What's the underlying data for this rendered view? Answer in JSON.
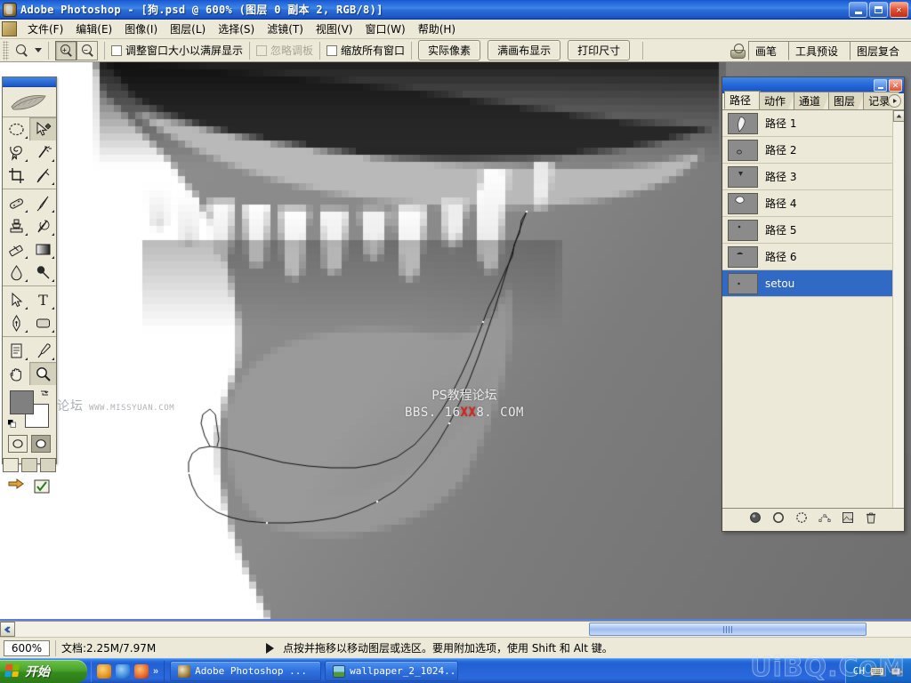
{
  "window": {
    "app_title": "Adobe Photoshop - [狗.psd @ 600% (图层 0 副本 2, RGB/8)]",
    "minimize_label": "最小化",
    "restore_label": "还原",
    "close_label": "关闭"
  },
  "menu": {
    "items": [
      {
        "label": "文件(F)"
      },
      {
        "label": "编辑(E)"
      },
      {
        "label": "图像(I)"
      },
      {
        "label": "图层(L)"
      },
      {
        "label": "选择(S)"
      },
      {
        "label": "滤镜(T)"
      },
      {
        "label": "视图(V)"
      },
      {
        "label": "窗口(W)"
      },
      {
        "label": "帮助(H)"
      }
    ]
  },
  "options_bar": {
    "active_tool": "zoom-tool",
    "checkbox_resize_windows": "调整窗口大小以满屏显示",
    "checkbox_ignore_palettes": "忽略调板",
    "checkbox_zoom_all_windows": "缩放所有窗口",
    "button_actual_pixels": "实际像素",
    "button_fit_on_screen": "满画布显示",
    "button_print_size": "打印尺寸",
    "dock_tabs": [
      "画笔",
      "工具预设",
      "图层复合"
    ]
  },
  "toolbox": {
    "foreground_color": "#808080",
    "background_color": "#ffffff",
    "tools": [
      {
        "name": "marquee-tool",
        "glyph": "ellipse"
      },
      {
        "name": "move-tool",
        "glyph": "move",
        "selected": true
      },
      {
        "name": "lasso-tool",
        "glyph": "lasso"
      },
      {
        "name": "magic-wand-tool",
        "glyph": "wand"
      },
      {
        "name": "crop-tool",
        "glyph": "crop"
      },
      {
        "name": "slice-tool",
        "glyph": "slice"
      },
      {
        "name": "healing-brush-tool",
        "glyph": "heal"
      },
      {
        "name": "brush-tool",
        "glyph": "brush"
      },
      {
        "name": "clone-stamp-tool",
        "glyph": "stamp"
      },
      {
        "name": "history-brush-tool",
        "glyph": "history"
      },
      {
        "name": "eraser-tool",
        "glyph": "eraser"
      },
      {
        "name": "gradient-tool",
        "glyph": "gradient"
      },
      {
        "name": "blur-tool",
        "glyph": "drop"
      },
      {
        "name": "dodge-tool",
        "glyph": "dodge"
      },
      {
        "name": "path-selection-tool",
        "glyph": "arrow"
      },
      {
        "name": "type-tool",
        "glyph": "T"
      },
      {
        "name": "pen-tool",
        "glyph": "pen"
      },
      {
        "name": "shape-tool",
        "glyph": "rect"
      },
      {
        "name": "notes-tool",
        "glyph": "note"
      },
      {
        "name": "eyedropper-tool",
        "glyph": "dropper"
      },
      {
        "name": "hand-tool",
        "glyph": "hand"
      },
      {
        "name": "zoom-tool",
        "glyph": "magnifier"
      }
    ]
  },
  "paths_panel": {
    "tabs": [
      {
        "label": "路径",
        "active": true
      },
      {
        "label": "动作",
        "active": false
      },
      {
        "label": "通道",
        "active": false
      },
      {
        "label": "图层",
        "active": false
      },
      {
        "label": "记录",
        "active": false
      }
    ],
    "rows": [
      {
        "name": "路径 1",
        "selected": false
      },
      {
        "name": "路径 2",
        "selected": false
      },
      {
        "name": "路径 3",
        "selected": false
      },
      {
        "name": "路径 4",
        "selected": false
      },
      {
        "name": "路径 5",
        "selected": false
      },
      {
        "name": "路径 6",
        "selected": false
      },
      {
        "name": "setou",
        "selected": true
      }
    ],
    "selected_color": "#316ac5",
    "footer_buttons": [
      {
        "name": "fill-path-button"
      },
      {
        "name": "stroke-path-button"
      },
      {
        "name": "load-path-as-selection-button"
      },
      {
        "name": "make-work-path-button"
      },
      {
        "name": "create-new-path-button"
      },
      {
        "name": "delete-path-button"
      }
    ]
  },
  "status_bar": {
    "zoom_level": "600%",
    "doc_info": "文档:2.25M/7.97M",
    "hint": "点按并拖移以移动图层或选区。要用附加选项，使用 Shift 和 Alt 键。"
  },
  "canvas": {
    "watermark_line1": "PS教程论坛",
    "watermark_line2_pre": "BBS. 16",
    "watermark_line2_red": "XX",
    "watermark_line2_post": "8. COM",
    "watermark_left_cn": "思缘设计论坛",
    "watermark_left_en": "WWW.MISSYUAN.COM"
  },
  "taskbar": {
    "start_label": "开始",
    "quicklaunch": [
      {
        "name": "media-player-icon",
        "color": "#f2a518"
      },
      {
        "name": "internet-explorer-icon",
        "color": "#2e7fd6"
      },
      {
        "name": "firefox-icon",
        "color": "#e25822"
      }
    ],
    "quicklaunch_more": "»",
    "tasks": [
      {
        "label": "Adobe Photoshop ...",
        "icon": "photoshop-icon",
        "active": true
      },
      {
        "label": "wallpaper_2_1024...",
        "icon": "image-icon",
        "active": false
      }
    ],
    "tray_language": "CH",
    "tray_icons": [
      {
        "name": "keyboard-icon"
      },
      {
        "name": "usb-device-icon"
      }
    ],
    "corner_watermark": "UiBQ.CoM"
  }
}
